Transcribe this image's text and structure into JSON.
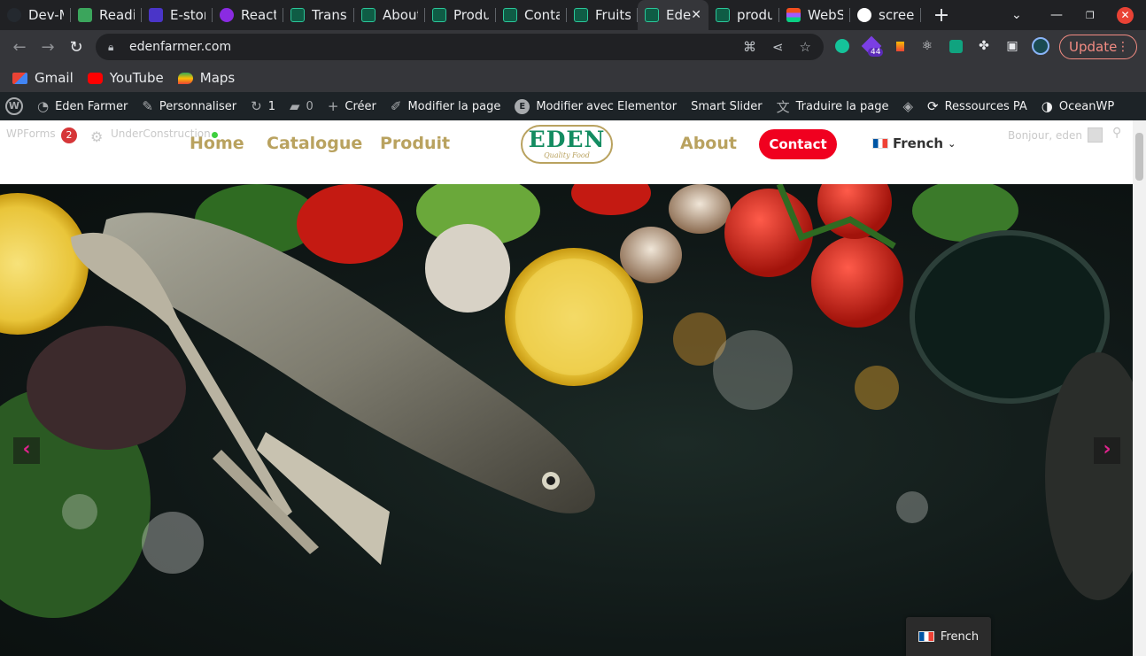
{
  "browser": {
    "tabs": [
      {
        "label": "Dev-M",
        "icon": "github-icon"
      },
      {
        "label": "Readi",
        "icon": "hexagon-icon"
      },
      {
        "label": "E-stor",
        "icon": "cart-icon"
      },
      {
        "label": "React",
        "icon": "react-u-icon"
      },
      {
        "label": "Trans",
        "icon": "eden-favicon"
      },
      {
        "label": "About",
        "icon": "eden-favicon"
      },
      {
        "label": "Produ",
        "icon": "eden-favicon"
      },
      {
        "label": "Conta",
        "icon": "eden-favicon"
      },
      {
        "label": "Fruits",
        "icon": "eden-favicon"
      },
      {
        "label": "Ede",
        "icon": "eden-favicon",
        "active": true
      },
      {
        "label": "produ",
        "icon": "eden-favicon"
      },
      {
        "label": "WebS",
        "icon": "figma-icon"
      },
      {
        "label": "screer",
        "icon": "google-icon"
      }
    ],
    "url": "edenfarmer.com",
    "update_label": "Update",
    "extension_badge": "44",
    "bookmarks": [
      {
        "label": "Gmail",
        "icon": "gmail-icon"
      },
      {
        "label": "YouTube",
        "icon": "youtube-icon"
      },
      {
        "label": "Maps",
        "icon": "maps-icon"
      }
    ]
  },
  "adminbar": {
    "site_name": "Eden Farmer",
    "customize": "Personnaliser",
    "updates_count": "1",
    "comments_count": "0",
    "new": "Créer",
    "edit_page": "Modifier la page",
    "edit_elementor": "Modifier avec Elementor",
    "smart_slider": "Smart Slider",
    "translate": "Traduire la page",
    "resources": "Ressources PA",
    "oceanwp": "OceanWP"
  },
  "site": {
    "ghost_wpforms": "WPForms",
    "ghost_badge": "2",
    "ghost_underconstruction": "UnderConstruction",
    "nav": {
      "home": "Home",
      "catalogue": "Catalogue",
      "produit": "Produit",
      "about": "About",
      "contact": "Contact"
    },
    "logo_title": "EDEN",
    "logo_subtitle": "Quality Food",
    "language": "French",
    "greeting": "Bonjour, eden",
    "float_language": "French"
  },
  "colors": {
    "nav_gold": "#b9a25f",
    "contact_red": "#f0001f",
    "logo_green": "#138c61",
    "slider_arrow": "#e0238d"
  }
}
